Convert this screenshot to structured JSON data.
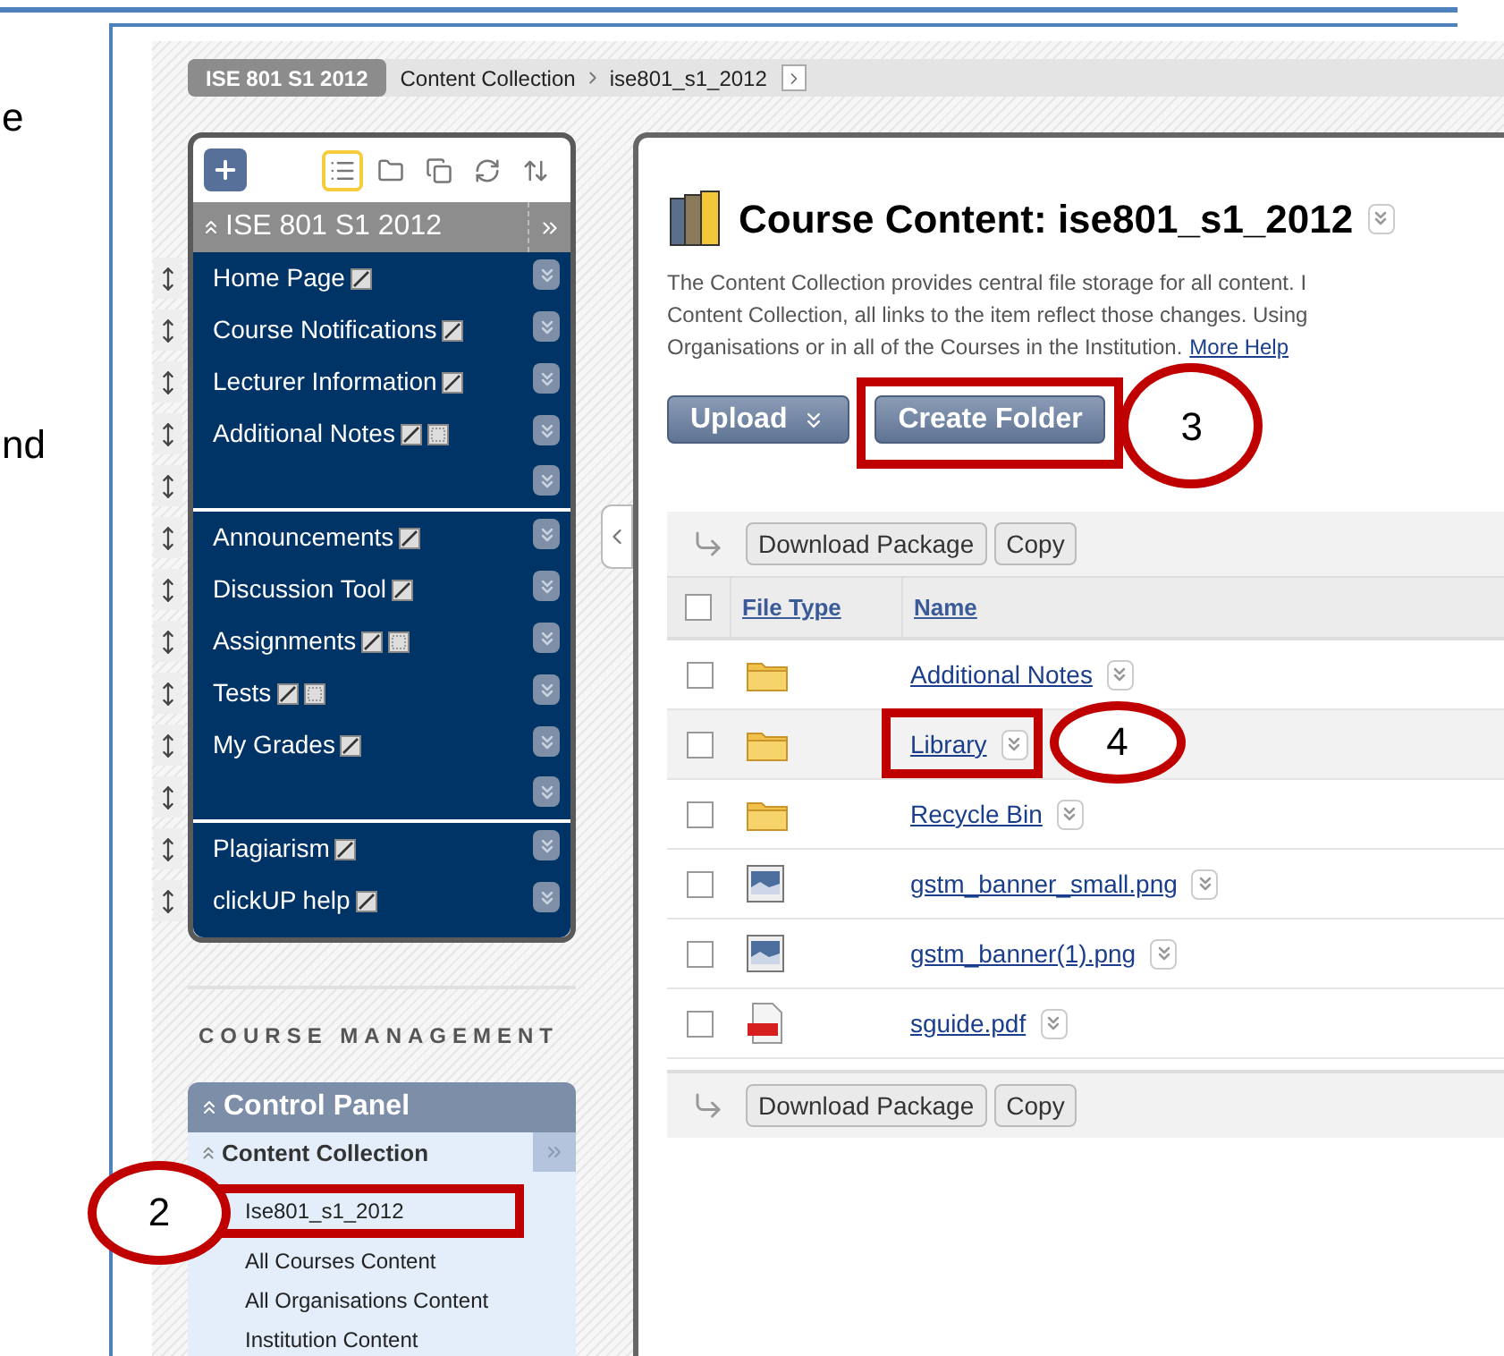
{
  "document_fragments": [
    "e",
    "nd"
  ],
  "breadcrumb": {
    "course": "ISE 801 S1 2012",
    "items": [
      "Content Collection",
      "ise801_s1_2012"
    ]
  },
  "course_menu": {
    "tools": [
      {
        "kind": "list",
        "selected": true
      },
      {
        "kind": "folder",
        "selected": false
      },
      {
        "kind": "windows",
        "selected": false
      },
      {
        "kind": "refresh",
        "selected": false
      },
      {
        "kind": "sort",
        "selected": false
      }
    ],
    "title": "ISE 801 S1 2012",
    "items": [
      {
        "kind": "link",
        "label": "Home Page",
        "adaptive_release": false
      },
      {
        "kind": "link",
        "label": "Course Notifications",
        "adaptive_release": false
      },
      {
        "kind": "link",
        "label": "Lecturer Information",
        "adaptive_release": false
      },
      {
        "kind": "link",
        "label": "Additional Notes",
        "adaptive_release": true
      },
      {
        "kind": "divider"
      },
      {
        "kind": "link",
        "label": "Announcements",
        "adaptive_release": false
      },
      {
        "kind": "link",
        "label": "Discussion Tool",
        "adaptive_release": false
      },
      {
        "kind": "link",
        "label": "Assignments",
        "adaptive_release": true
      },
      {
        "kind": "link",
        "label": "Tests",
        "adaptive_release": true
      },
      {
        "kind": "link",
        "label": "My Grades",
        "adaptive_release": false
      },
      {
        "kind": "divider"
      },
      {
        "kind": "link",
        "label": "Plagiarism",
        "adaptive_release": false
      },
      {
        "kind": "link",
        "label": "clickUP help",
        "adaptive_release": false
      }
    ]
  },
  "course_management": {
    "heading": "COURSE MANAGEMENT",
    "panel_title": "Control Panel",
    "section": {
      "label": "Content Collection",
      "expanded": true,
      "items": [
        {
          "label": "Ise801_s1_2012",
          "callout": "2"
        },
        {
          "label": "All Courses Content"
        },
        {
          "label": "All Organisations Content"
        },
        {
          "label": "Institution Content"
        }
      ]
    }
  },
  "content": {
    "title": "Course Content: ise801_s1_2012",
    "description": [
      "The Content Collection provides central file storage for all content. I",
      "Content Collection, all links to the item reflect those changes. Using",
      "Organisations or in all of the Courses in the Institution."
    ],
    "help_link": "More Help",
    "buttons": [
      {
        "label": "Upload",
        "dropdown": true
      },
      {
        "label": "Create Folder",
        "dropdown": false,
        "callout": "3"
      }
    ],
    "actions": [
      "Download Package",
      "Copy"
    ],
    "columns": [
      "File Type",
      "Name"
    ],
    "select_all_checked": false,
    "rows": [
      {
        "kind": "folder",
        "name": "Additional Notes",
        "checked": false,
        "highlighted": false
      },
      {
        "kind": "folder",
        "name": "Library",
        "checked": false,
        "highlighted": true,
        "callout": "4"
      },
      {
        "kind": "folder",
        "name": "Recycle Bin",
        "checked": false,
        "highlighted": false
      },
      {
        "kind": "image",
        "name": "gstm_banner_small.png",
        "checked": false,
        "highlighted": false
      },
      {
        "kind": "image",
        "name": "gstm_banner(1).png",
        "checked": false,
        "highlighted": false
      },
      {
        "kind": "pdf",
        "name": "sguide.pdf",
        "checked": false,
        "highlighted": false
      }
    ],
    "bottom_actions": [
      "Download Package",
      "Copy"
    ]
  }
}
